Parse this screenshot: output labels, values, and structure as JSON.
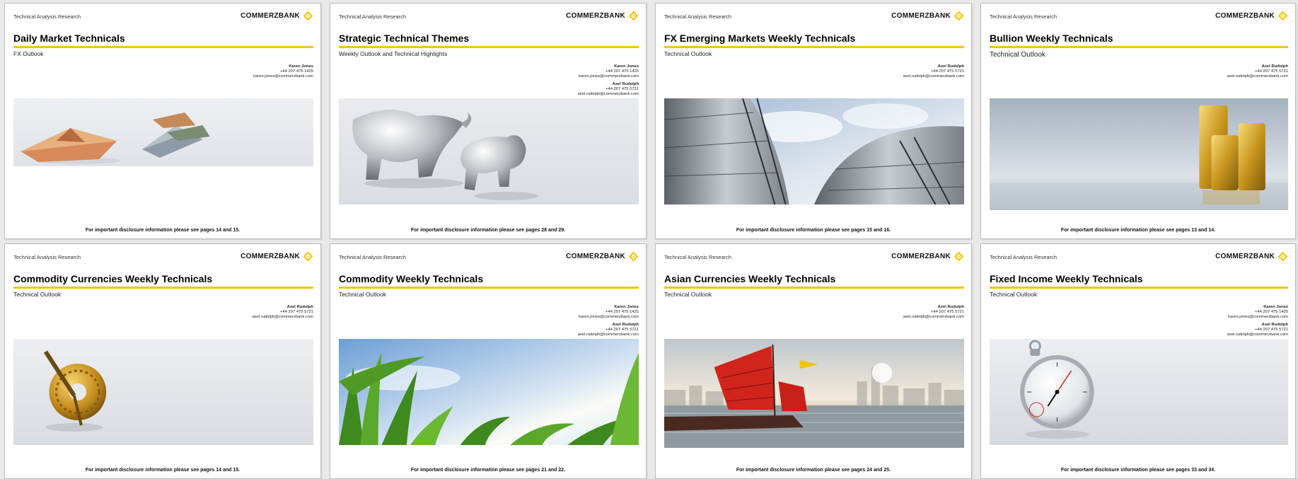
{
  "header_small": "Technical Analysis Research",
  "brand": "COMMERZBANK",
  "colors": {
    "accent": "#f5c400",
    "logo_yellow": "#f5c400"
  },
  "cards": [
    {
      "title": "Daily Market Technicals",
      "subtitle": "FX Outlook",
      "contacts": [
        {
          "name": "Karen Jones",
          "phone": "+44 207 475 1425",
          "email": "karen.jones@commerzbank.com"
        }
      ],
      "image": "origami-money-boats",
      "footer": "For important disclosure information please see pages 14 and 15."
    },
    {
      "title": "Strategic Technical Themes",
      "subtitle": "Weekly Outlook and Technical Highlights",
      "contacts": [
        {
          "name": "Karen Jones",
          "phone": "+44 207 475 1425",
          "email": "karen.jones@commerzbank.com"
        },
        {
          "name": "Axel Rudolph",
          "phone": "+44 207 475 5721",
          "email": "axel.rudolph@commerzbank.com"
        }
      ],
      "image": "silver-bull-bear",
      "footer": "For important disclosure information please see pages 28 and 29."
    },
    {
      "title": "FX Emerging Markets Weekly Technicals",
      "subtitle": "Technical Outlook",
      "contacts": [
        {
          "name": "Axel Rudolph",
          "phone": "+44 207 475 5721",
          "email": "axel.rudolph@commerzbank.com"
        }
      ],
      "image": "steel-tanks-sky",
      "footer": "For important disclosure information please see pages 15 and 16."
    },
    {
      "title": "Bullion Weekly Technicals",
      "subtitle": "Technical Outlook",
      "contacts": [
        {
          "name": "Axel Rudolph",
          "phone": "+44 207 475 5721",
          "email": "axel.rudolph@commerzbank.com"
        }
      ],
      "image": "gold-bars",
      "footer": "For important disclosure information please see pages 13 and 14."
    },
    {
      "title": "Commodity Currencies Weekly Technicals",
      "subtitle": "Technical Outlook",
      "contacts": [
        {
          "name": "Axel Rudolph",
          "phone": "+44 207 475 5721",
          "email": "axel.rudolph@commerzbank.com"
        }
      ],
      "image": "golden-gear",
      "footer": "For important disclosure information please see pages 14 and 15."
    },
    {
      "title": "Commodity Weekly Technicals",
      "subtitle": "Technical Outlook",
      "contacts": [
        {
          "name": "Karen Jones",
          "phone": "+44 207 475 1425",
          "email": "karen.jones@commerzbank.com"
        },
        {
          "name": "Axel Rudolph",
          "phone": "+44 207 475 5721",
          "email": "axel.rudolph@commerzbank.com"
        }
      ],
      "image": "corn-field-sky",
      "footer": "For important disclosure information please see pages 21 and 22."
    },
    {
      "title": "Asian Currencies Weekly Technicals",
      "subtitle": "Technical Outlook",
      "contacts": [
        {
          "name": "Axel Rudolph",
          "phone": "+44 207 475 5721",
          "email": "axel.rudolph@commerzbank.com"
        }
      ],
      "image": "junk-boat-harbour",
      "footer": "For important disclosure information please see pages 24 and 25."
    },
    {
      "title": "Fixed Income Weekly Technicals",
      "subtitle": "Technical Outlook",
      "contacts": [
        {
          "name": "Karen Jones",
          "phone": "+44 207 475 1425",
          "email": "karen.jones@commerzbank.com"
        },
        {
          "name": "Axel Rudolph",
          "phone": "+44 207 475 5721",
          "email": "axel.rudolph@commerzbank.com"
        }
      ],
      "image": "stopwatch",
      "footer": "For important disclosure information please see pages 33 and 34."
    }
  ]
}
